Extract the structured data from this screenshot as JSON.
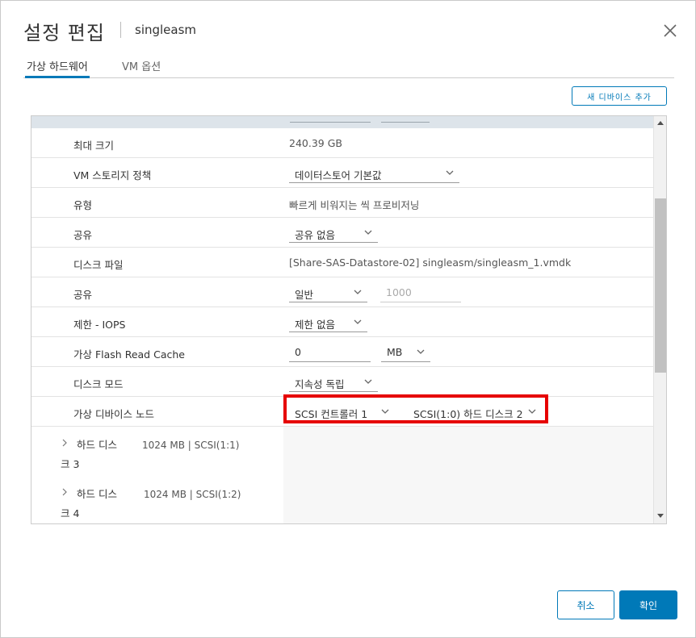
{
  "header": {
    "title": "설정 편집",
    "vm_name": "singleasm"
  },
  "tabs": [
    {
      "label": "가상 하드웨어",
      "active": true
    },
    {
      "label": "VM 옵션",
      "active": false
    }
  ],
  "toolbar": {
    "add_device_label": "새 디바이스 추가"
  },
  "rows": {
    "max_size": {
      "label": "최대 크기",
      "value": "240.39 GB"
    },
    "storage_policy": {
      "label": "VM 스토리지 정책",
      "value": "데이터스토어 기본값"
    },
    "type": {
      "label": "유형",
      "value": "빠르게 비워지는 씩 프로비저닝"
    },
    "sharing": {
      "label": "공유",
      "value": "공유 없음"
    },
    "disk_file": {
      "label": "디스크 파일",
      "value": "[Share-SAS-Datastore-02] singleasm/singleasm_1.vmdk"
    },
    "shares": {
      "label": "공유",
      "value": "일반",
      "amount_placeholder": "1000"
    },
    "limit_iops": {
      "label": "제한 - IOPS",
      "value": "제한 없음"
    },
    "flash_cache": {
      "label": "가상 Flash Read Cache",
      "value": "0",
      "unit": "MB"
    },
    "disk_mode": {
      "label": "디스크 모드",
      "value": "지속성 독립"
    },
    "device_node": {
      "label": "가상 디바이스 노드",
      "controller": "SCSI 컨트롤러 1",
      "node": "SCSI(1:0) 하드 디스크 2"
    }
  },
  "collapsed_disks": [
    {
      "name": "하드 디스크 3",
      "info": "1024 MB | SCSI(1:1)"
    },
    {
      "name": "하드 디스크 4",
      "info": "1024 MB | SCSI(1:2)"
    }
  ],
  "footer": {
    "cancel_label": "취소",
    "ok_label": "확인"
  },
  "colors": {
    "accent": "#0079b8",
    "highlight": "#e60000"
  }
}
